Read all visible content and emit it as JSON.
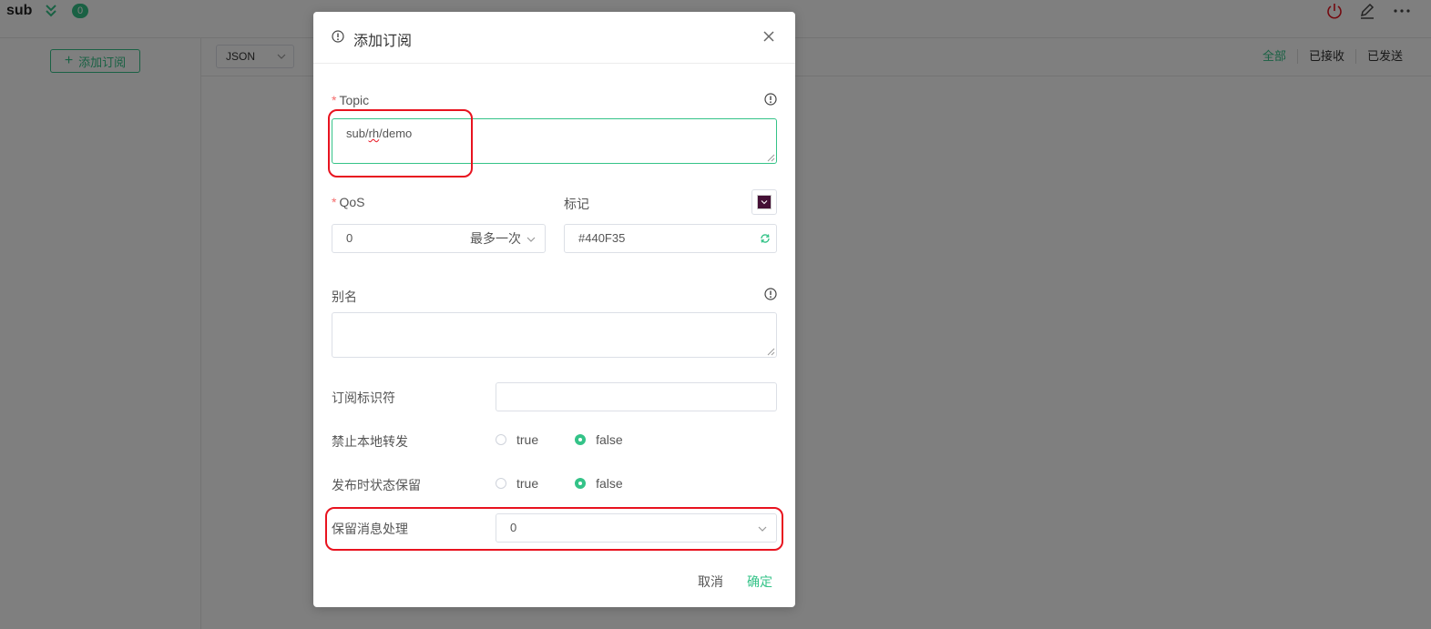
{
  "app": {
    "connection_name": "sub",
    "message_count": "0",
    "add_subscription_label": "添加订阅",
    "format_select": "JSON",
    "filter_tabs": [
      "全部",
      "已接收",
      "已发送"
    ],
    "active_filter": "全部"
  },
  "dialog": {
    "title": "添加订阅",
    "topic": {
      "label": "Topic",
      "value_parts": [
        "sub/",
        "rh",
        "/demo"
      ]
    },
    "qos": {
      "label": "QoS",
      "value": "0",
      "value_desc": "最多一次"
    },
    "color": {
      "label": "标记",
      "value": "#440F35"
    },
    "alias": {
      "label": "别名",
      "value": ""
    },
    "subscription_identifier": {
      "label": "订阅标识符",
      "value": ""
    },
    "no_local": {
      "label": "禁止本地转发",
      "options": [
        "true",
        "false"
      ],
      "selected": "false"
    },
    "retain_as_published": {
      "label": "发布时状态保留",
      "options": [
        "true",
        "false"
      ],
      "selected": "false"
    },
    "retain_handling": {
      "label": "保留消息处理",
      "value": "0"
    },
    "cancel_label": "取消",
    "confirm_label": "确定"
  },
  "colors": {
    "accent": "#34c388",
    "required": "#f56c6c",
    "annotation": "#e8131f",
    "power": "#e8131f"
  }
}
